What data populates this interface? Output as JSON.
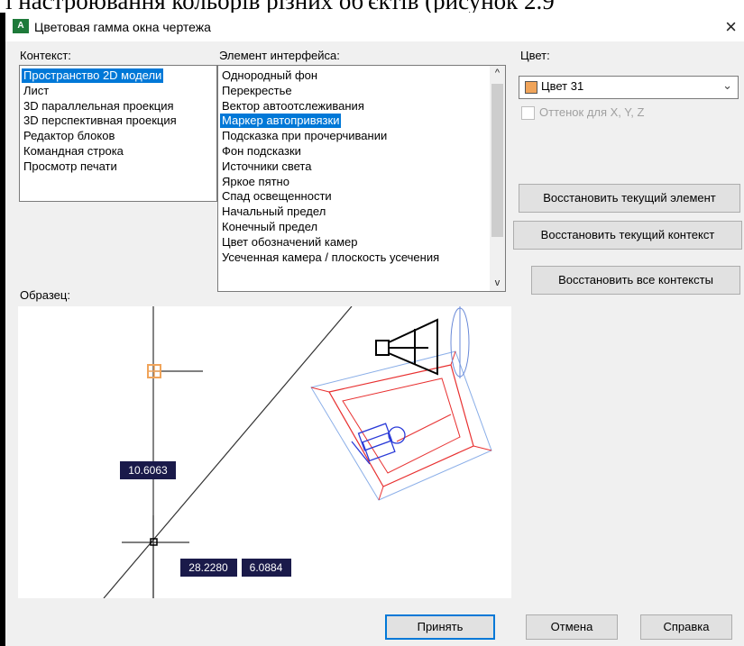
{
  "document": {
    "heading_fragment": "і настроювання кольорів різних об'єктів (рисунок 2.9"
  },
  "window": {
    "app_icon_text": "A",
    "title": "Цветовая гамма окна чертежа",
    "close": "×"
  },
  "context": {
    "label": "Контекст:",
    "items": [
      "Пространство 2D модели",
      "Лист",
      "3D параллельная проекция",
      "3D перспективная проекция",
      "Редактор блоков",
      "Командная строка",
      "Просмотр печати"
    ],
    "selected_index": 0
  },
  "interface_element": {
    "label": "Элемент интерфейса:",
    "items": [
      "Однородный фон",
      "Перекрестье",
      "Вектор автоотслеживания",
      "Маркер автопривязки",
      "Подсказка при прочерчивании",
      "Фон подсказки",
      "Источники света",
      "Яркое пятно",
      "Спад освещенности",
      "Начальный предел",
      "Конечный предел",
      "Цвет обозначений камер",
      "Усеченная камера / плоскость усечения"
    ],
    "selected_index": 3,
    "scroll_up": "^",
    "scroll_down": "v"
  },
  "color": {
    "label": "Цвет:",
    "value": "Цвет 31",
    "swatch_color": "#f0a45a",
    "tint_checkbox_label": "Оттенок для X, Y, Z",
    "tint_checked": false
  },
  "buttons": {
    "restore_element": "Восстановить текущий элемент",
    "restore_context": "Восстановить текущий контекст",
    "restore_all": "Восстановить все контексты",
    "apply": "Принять",
    "cancel": "Отмена",
    "help": "Справка"
  },
  "preview": {
    "label": "Образец:",
    "dim_a": "10.6063",
    "dim_b": "28.2280",
    "dim_c": "6.0884"
  },
  "colors": {
    "selection": "#0078d7",
    "marker": "#f0a45a",
    "red_lines": "#e83030",
    "blue_lines": "#2b3bd8"
  }
}
